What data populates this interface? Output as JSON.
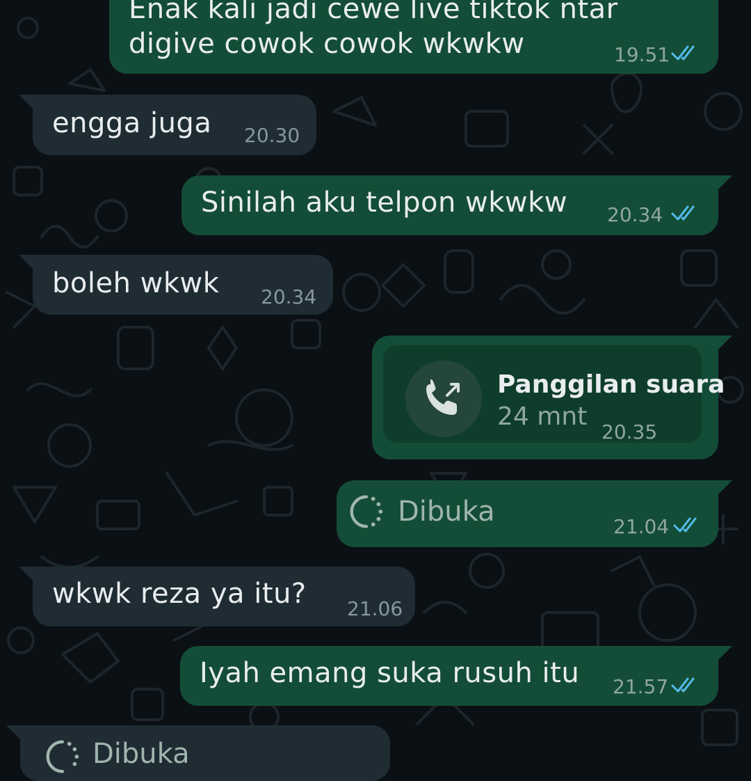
{
  "theme": {
    "background": "#0b1014",
    "outgoing_bubble": "#144d37",
    "incoming_bubble": "#1f2c33",
    "read_tick_color": "#53bdeb"
  },
  "messages": [
    {
      "direction": "outgoing",
      "text_lines": [
        "Enak kali jadi cewe live tiktok ntar",
        "digive cowok cowok wkwkw"
      ],
      "time": "19.51",
      "status": "read"
    },
    {
      "direction": "incoming",
      "text": "engga juga",
      "time": "20.30"
    },
    {
      "direction": "outgoing",
      "text": "Sinilah aku telpon wkwkw",
      "time": "20.34",
      "status": "read"
    },
    {
      "direction": "incoming",
      "text": "boleh wkwk",
      "time": "20.34"
    },
    {
      "direction": "outgoing",
      "type": "voice_call",
      "title": "Panggilan suara",
      "duration": "24 mnt",
      "time": "20.35",
      "icon": "outgoing-call-icon"
    },
    {
      "direction": "outgoing",
      "type": "view_once",
      "label": "Dibuka",
      "time": "21.04",
      "status": "read",
      "icon": "view-once-icon"
    },
    {
      "direction": "incoming",
      "text": "wkwk reza ya itu?",
      "time": "21.06"
    },
    {
      "direction": "outgoing",
      "text": "Iyah emang suka rusuh itu",
      "time": "21.57",
      "status": "read"
    },
    {
      "direction": "incoming",
      "type": "view_once",
      "label": "Dibuka",
      "icon": "view-once-icon"
    }
  ]
}
